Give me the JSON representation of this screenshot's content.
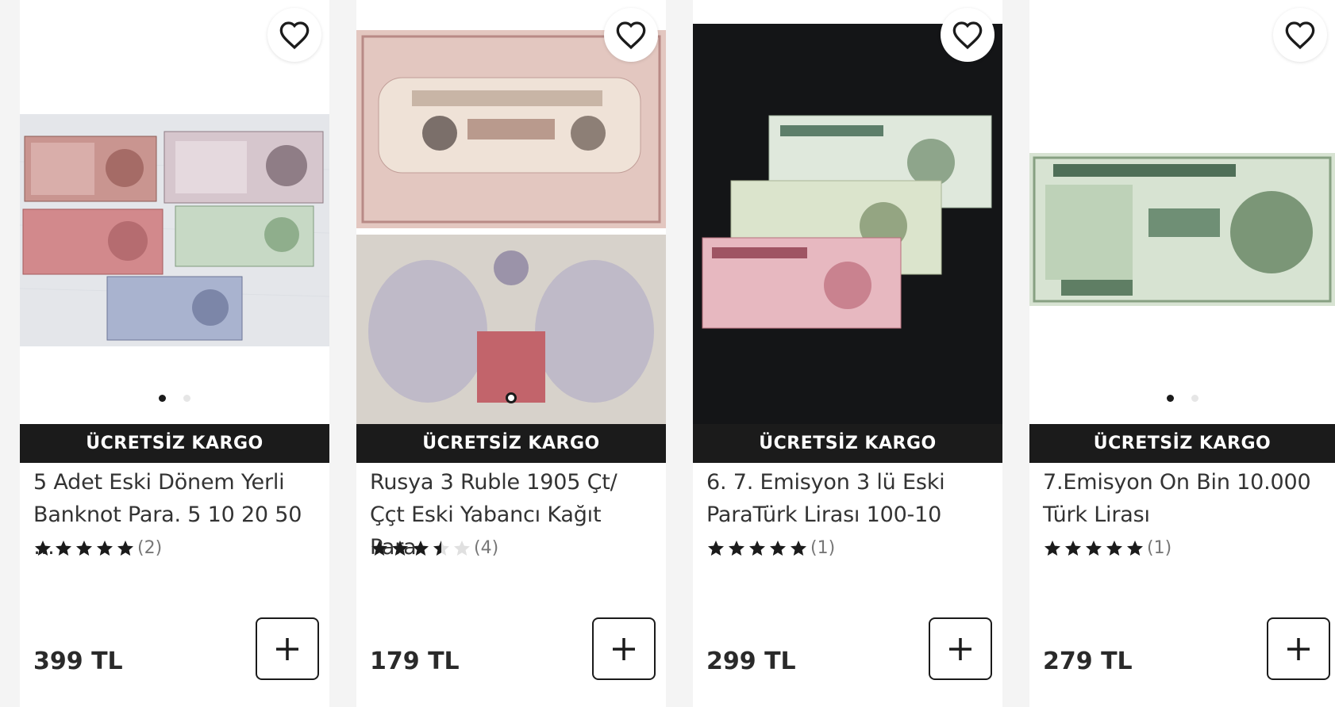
{
  "products": [
    {
      "badge": "ÜCRETSİZ KARGO",
      "title": "5 Adet Eski Dönem Yerli Banknot Para. 5 10 20 50 …",
      "rating": 5,
      "review_count": "(2)",
      "price": "399 TL",
      "favorite_icon": "heart-outline-icon",
      "add_icon": "plus-icon",
      "image": "five-turkish-banknotes-photo",
      "carousel": {
        "count": 2,
        "active": 1
      }
    },
    {
      "badge": "ÜCRETSİZ KARGO",
      "title": "Rusya 3 Ruble 1905 Çt/Ççt Eski Yabancı Kağıt Para",
      "rating": 3.5,
      "review_count": "(4)",
      "price": "179 TL",
      "favorite_icon": "heart-outline-icon",
      "add_icon": "plus-icon",
      "image": "russian-3-ruble-1905-banknote-photo",
      "carousel": {
        "count": 1,
        "active": 1
      }
    },
    {
      "badge": "ÜCRETSİZ KARGO",
      "title": "6. 7. Emisyon 3 lü Eski ParaTürk Lirası 100-10",
      "rating": 5,
      "review_count": "(1)",
      "price": "299 TL",
      "favorite_icon": "heart-outline-icon",
      "add_icon": "plus-icon",
      "image": "three-turkish-lira-banknotes-photo",
      "carousel": {
        "count": 0,
        "active": 0
      }
    },
    {
      "badge": "ÜCRETSİZ KARGO",
      "title": "7.Emisyon On Bin 10.000 Türk Lirası",
      "rating": 5,
      "review_count": "(1)",
      "price": "279 TL",
      "favorite_icon": "heart-outline-icon",
      "add_icon": "plus-icon",
      "image": "ten-thousand-turkish-lira-banknote-photo",
      "carousel": {
        "count": 2,
        "active": 1
      }
    }
  ],
  "colors": {
    "badge_bg": "#1b1b1b",
    "star_filled": "#1b1b1b",
    "star_empty": "#e0e0e0",
    "text": "#333333"
  }
}
